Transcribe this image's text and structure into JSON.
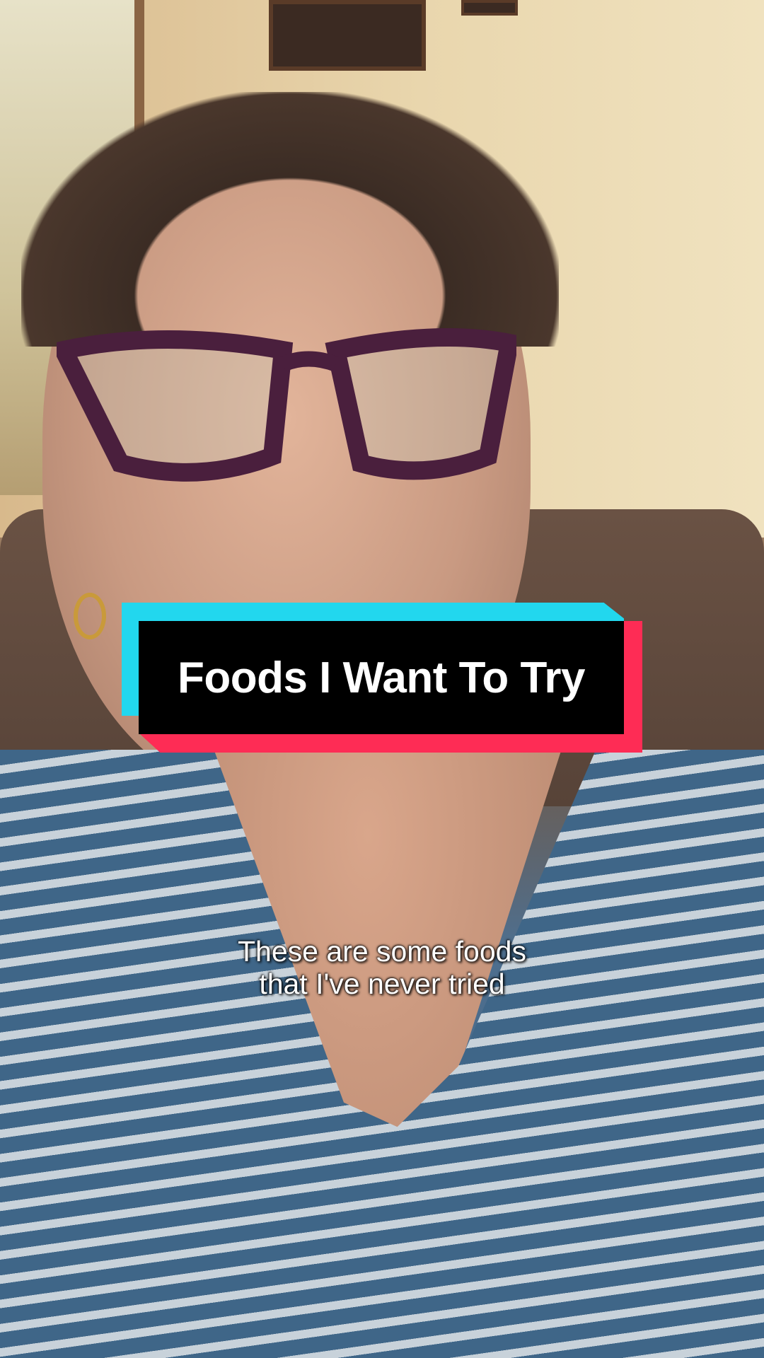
{
  "title_card": {
    "text": "Foods I Want To Try",
    "colors": {
      "cyan": "#22d7ee",
      "pink": "#fe2c55",
      "background": "#000000",
      "text": "#ffffff"
    }
  },
  "caption": {
    "lines": [
      "These are some foods",
      "that I've never tried"
    ]
  }
}
